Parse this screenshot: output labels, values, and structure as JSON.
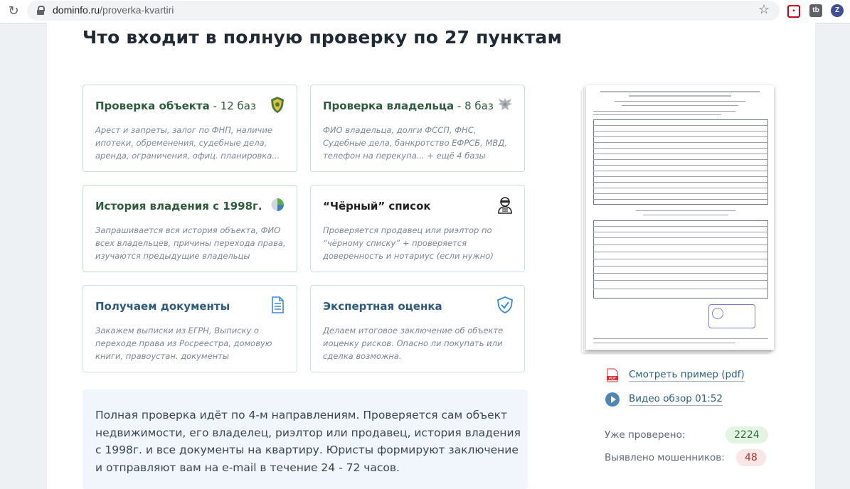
{
  "browser": {
    "url_domain": "dominfo.ru",
    "url_path": "/proverka-kvartiri"
  },
  "page": {
    "title": "Что входит в полную проверку по 27 пунктам",
    "cards": [
      {
        "title": "Проверка объекта",
        "count": " - 12 баз",
        "desc": "Арест и запреты, залог по ФНП, наличие ипотеки, обременения, судебные дела, аренда, ограничения, офиц. планировка...",
        "icon": "rosreestr-emblem-icon",
        "color": "#2e5b3e"
      },
      {
        "title": "Проверка владельца",
        "count": " - 8 баз",
        "desc": "ФИО владельца, долги ФССП, ФНС, Судебные дела, банкротство ЕФРСБ, МВД, телефон на перекупа... + ещё 4 базы",
        "icon": "eagle-emblem-icon",
        "color": "#2c5a80"
      },
      {
        "title": "История владения с 1998г.",
        "count": "",
        "desc": "Запрашивается вся история объекта, ФИО всех владельцев, причины перехода права, изучаются предыдущие владельцы",
        "icon": "rosreestr-logo-icon",
        "color": "#2e5b3e"
      },
      {
        "title": "“Чёрный” список",
        "count": "",
        "desc": "Проверяется продавец или риэлтор по “чёрному списку” + проверяется доверенность и нотариус (если нужно)",
        "icon": "thief-icon",
        "color": "#222222"
      },
      {
        "title": "Получаем документы",
        "count": "",
        "desc": "Закажем выписки из ЕГРН, Выписку о переходе права из Росреестра, домовую книги, правоустан. документы",
        "icon": "document-icon",
        "color": "#2c5a80"
      },
      {
        "title": "Экспертная оценка",
        "count": "",
        "desc": "Делаем итоговое заключение об объекте иоценку рисков. Опасно ли покупать или сделка возможна.",
        "icon": "shield-check-icon",
        "color": "#2c5a80"
      }
    ],
    "info_text": "Полная проверка идёт по 4-м направлениям. Проверяется сам объект недвижимости, его владелец, риэлтор или продавец, история владения с 1998г. и все документы на квартиру. Юристы формируют заключение и отправляют вам на e-mail в течение 24 - 72 часов.",
    "sample_link": "Смотреть пример (pdf)",
    "video_link": "Видео обзор 01:52",
    "stats": {
      "checked_label": "Уже проверено:",
      "checked_value": "2224",
      "fraud_label": "Выявлено мошенников:",
      "fraud_value": "48"
    }
  }
}
